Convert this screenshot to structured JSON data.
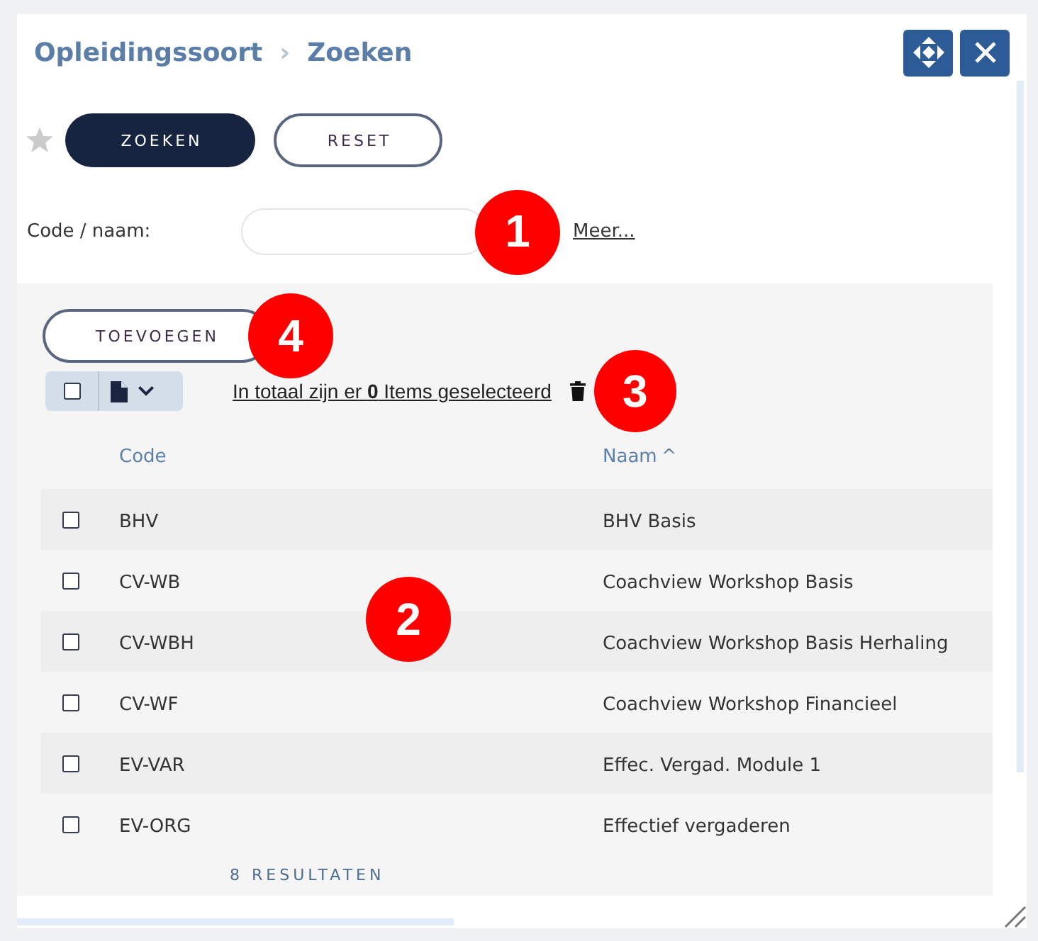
{
  "header": {
    "breadcrumb": [
      "Opleidingssoort",
      "Zoeken"
    ],
    "separator": "›",
    "window_buttons": [
      {
        "kind": "move"
      },
      {
        "kind": "close"
      }
    ]
  },
  "toolbar": {
    "favorite": {
      "on": false
    },
    "buttons": [
      {
        "label": "ZOEKEN",
        "kind": "primary"
      },
      {
        "label": "RESET",
        "kind": "secondary"
      }
    ]
  },
  "search": {
    "field_label": "Code / naam:",
    "callout": "1",
    "more_link": "Meer..."
  },
  "results": {
    "add_button": {
      "label": "TOEVOEGEN",
      "callout": "4"
    },
    "selection": {
      "select_all_checked": false,
      "summary": "In totaal zijn er **0** Items geselecteerd",
      "callout": "3"
    },
    "columns": [
      {
        "label": "Code"
      },
      {
        "label": "Naam",
        "sort_mark": "^"
      }
    ],
    "rows": [
      {
        "code": "BHV",
        "name": "BHV Basis",
        "checked": false
      },
      {
        "code": "CV-WB",
        "name": "Coachview Workshop Basis",
        "checked": false
      },
      {
        "code": "CV-WBH",
        "name": "Coachview Workshop Basis Herhaling",
        "checked": false
      },
      {
        "code": "CV-WF",
        "name": "Coachview Workshop Financieel",
        "checked": false
      },
      {
        "code": "EV-VAR",
        "name": "Effec. Vergad. Module 1",
        "checked": false
      },
      {
        "code": "EV-ORG",
        "name": "Effectief vergaderen",
        "checked": false
      }
    ],
    "callout": "2",
    "count": "8 RESULTATEN"
  }
}
